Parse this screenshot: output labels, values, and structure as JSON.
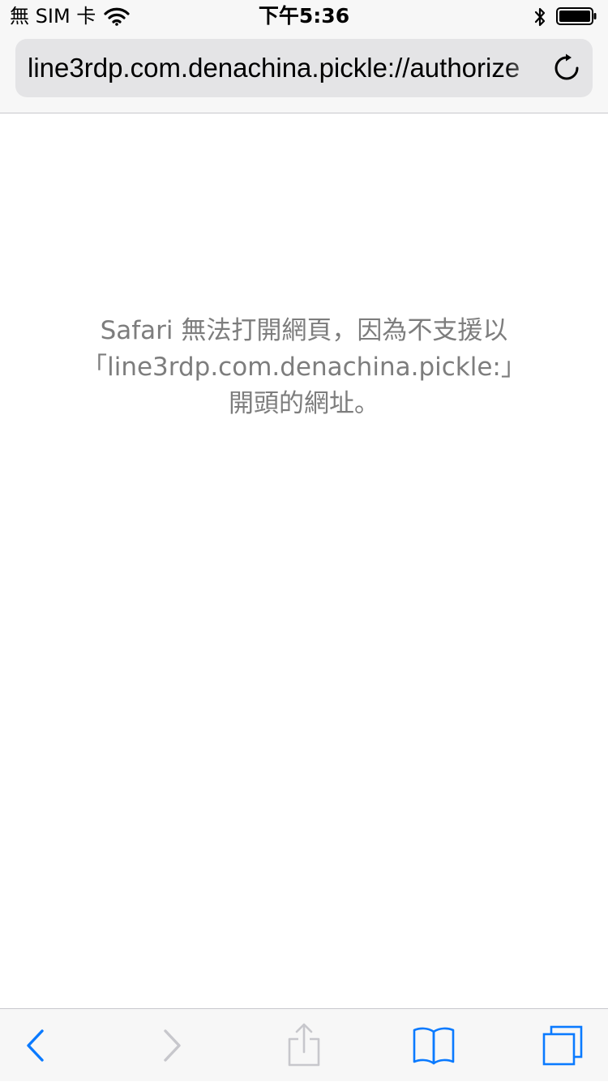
{
  "status_bar": {
    "carrier": "無 SIM 卡",
    "time": "下午5:36",
    "icons": [
      "wifi-icon",
      "bluetooth-icon",
      "battery-icon"
    ]
  },
  "address_bar": {
    "url": "line3rdp.com.denachina.pickle://authorize",
    "reload_icon": "reload-icon"
  },
  "error_message": {
    "line1": "Safari 無法打開網頁，因為不支援以",
    "line2": "「line3rdp.com.denachina.pickle:」",
    "line3": "開頭的網址。"
  },
  "toolbar": {
    "buttons": [
      {
        "name": "back-icon",
        "enabled": true
      },
      {
        "name": "forward-icon",
        "enabled": false
      },
      {
        "name": "share-icon",
        "enabled": false
      },
      {
        "name": "bookmarks-icon",
        "enabled": true
      },
      {
        "name": "tabs-icon",
        "enabled": true
      }
    ]
  },
  "colors": {
    "accent": "#0a7aff",
    "disabled": "#c7c7cc",
    "message_text": "#7d7d7d",
    "url_field": "#e4e4e6",
    "chrome_bg": "#f7f7f7"
  }
}
